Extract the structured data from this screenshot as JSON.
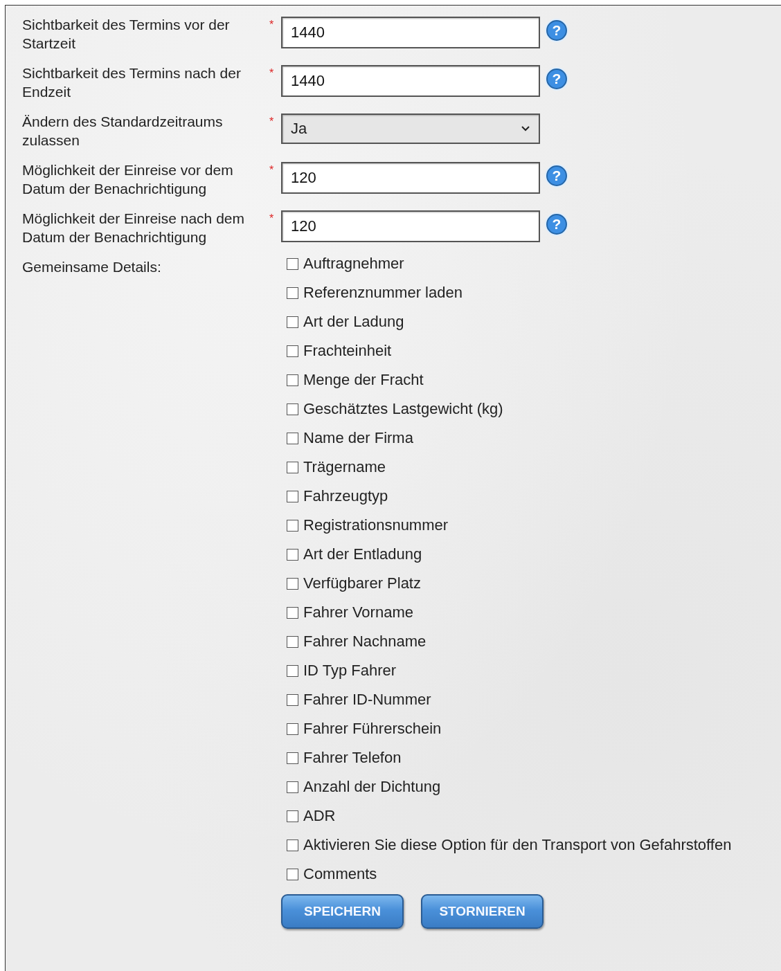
{
  "fields": [
    {
      "kind": "input",
      "label": "Sichtbarkeit des Termins vor der Startzeit",
      "required_mark": "*",
      "value": "1440",
      "help": "?"
    },
    {
      "kind": "input",
      "label": "Sichtbarkeit des Termins nach der Endzeit",
      "required_mark": "*",
      "value": "1440",
      "help": "?"
    },
    {
      "kind": "select",
      "label": "Ändern des Standardzeitraums zulassen",
      "required_mark": "*",
      "value": "Ja"
    },
    {
      "kind": "input",
      "label": "Möglichkeit der Einreise vor dem Datum der Benachrichtigung",
      "required_mark": "*",
      "value": "120",
      "help": "?"
    },
    {
      "kind": "input",
      "label": "Möglichkeit der Einreise nach dem Datum der Benachrichtigung",
      "required_mark": "*",
      "value": "120",
      "help": "?"
    }
  ],
  "details": {
    "label": "Gemeinsame Details:",
    "options": [
      {
        "label": "Auftragnehmer",
        "checked": false
      },
      {
        "label": "Referenznummer laden",
        "checked": false
      },
      {
        "label": "Art der Ladung",
        "checked": false
      },
      {
        "label": "Frachteinheit",
        "checked": false
      },
      {
        "label": "Menge der Fracht",
        "checked": false
      },
      {
        "label": "Geschätztes Lastgewicht (kg)",
        "checked": false
      },
      {
        "label": "Name der Firma",
        "checked": false
      },
      {
        "label": "Trägername",
        "checked": false
      },
      {
        "label": "Fahrzeugtyp",
        "checked": false
      },
      {
        "label": "Registrationsnummer",
        "checked": false
      },
      {
        "label": "Art der Entladung",
        "checked": false
      },
      {
        "label": "Verfügbarer Platz",
        "checked": false
      },
      {
        "label": "Fahrer Vorname",
        "checked": false
      },
      {
        "label": "Fahrer Nachname",
        "checked": false
      },
      {
        "label": "ID Typ Fahrer",
        "checked": false
      },
      {
        "label": "Fahrer ID-Nummer",
        "checked": false
      },
      {
        "label": "Fahrer Führerschein",
        "checked": false
      },
      {
        "label": "Fahrer Telefon",
        "checked": false
      },
      {
        "label": "Anzahl der Dichtung",
        "checked": false
      },
      {
        "label": "ADR",
        "checked": false
      },
      {
        "label": "Aktivieren Sie diese Option für den Transport von Gefahrstoffen",
        "checked": false
      },
      {
        "label": "Comments",
        "checked": false
      }
    ]
  },
  "buttons": [
    "SPEICHERN",
    "STORNIEREN"
  ]
}
